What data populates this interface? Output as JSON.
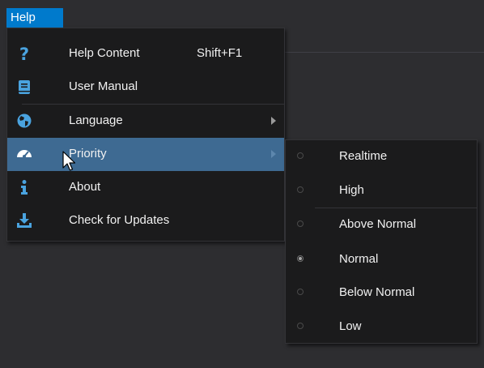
{
  "menubar": {
    "help_label": "Help"
  },
  "help_menu": {
    "items": [
      {
        "label": "Help Content",
        "shortcut": "Shift+F1",
        "icon": "question-mark-icon"
      },
      {
        "label": "User Manual",
        "icon": "book-icon"
      },
      {
        "label": "Language",
        "icon": "globe-icon",
        "has_submenu": true
      },
      {
        "label": "Priority",
        "icon": "speedometer-icon",
        "has_submenu": true,
        "highlighted": true
      },
      {
        "label": "About",
        "icon": "info-icon"
      },
      {
        "label": "Check for Updates",
        "icon": "download-icon"
      }
    ]
  },
  "priority_submenu": {
    "items": [
      {
        "label": "Realtime",
        "selected": false
      },
      {
        "label": "High",
        "selected": false
      },
      {
        "label": "Above Normal",
        "selected": false
      },
      {
        "label": "Normal",
        "selected": true
      },
      {
        "label": "Below Normal",
        "selected": false
      },
      {
        "label": "Low",
        "selected": false
      }
    ]
  },
  "colors": {
    "accent": "#007acc",
    "highlight": "#3e6a92",
    "icon_blue": "#4aa3df",
    "menu_bg": "#1b1b1c",
    "window_bg": "#2d2d30"
  }
}
